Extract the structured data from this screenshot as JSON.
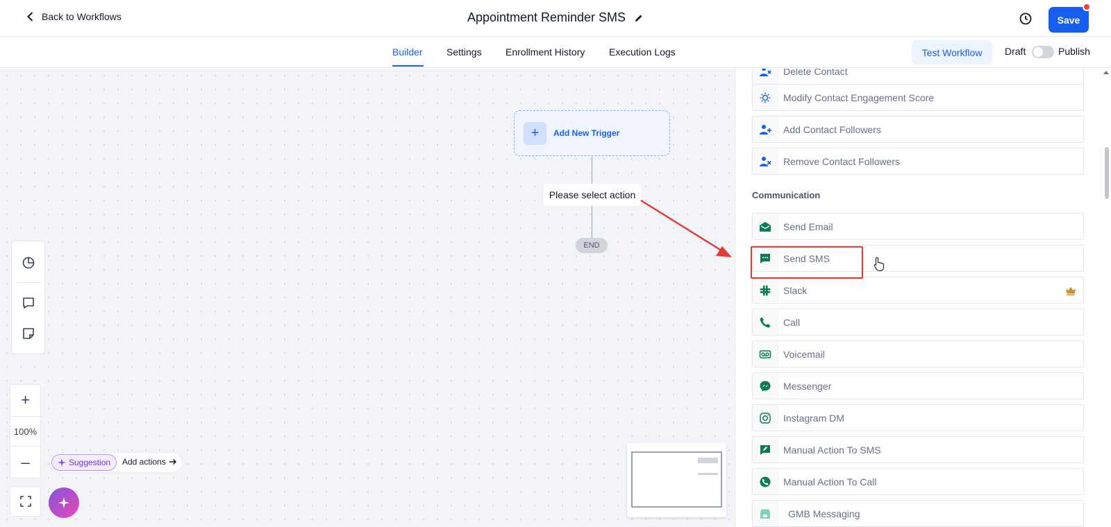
{
  "header": {
    "back_label": "Back to Workflows",
    "workflow_title": "Appointment Reminder SMS",
    "save_label": "Save"
  },
  "tabs": [
    {
      "label": "Builder",
      "active": true
    },
    {
      "label": "Settings",
      "active": false
    },
    {
      "label": "Enrollment History",
      "active": false
    },
    {
      "label": "Execution Logs",
      "active": false
    }
  ],
  "tab_actions": {
    "test_workflow_label": "Test Workflow",
    "draft_label": "Draft",
    "publish_label": "Publish",
    "publish_toggle_on": false
  },
  "canvas": {
    "trigger_label": "Add New Trigger",
    "action_placeholder": "Please select action",
    "end_label": "END",
    "zoom_level": "100%",
    "suggestion_label": "Suggestion",
    "add_actions_label": "Add actions"
  },
  "panel": {
    "top_rows": [
      {
        "label": "Delete Contact",
        "icon": "user-x-icon"
      },
      {
        "label": "Modify Contact Engagement Score",
        "icon": "engagement-icon"
      },
      {
        "label": "Add Contact Followers",
        "icon": "user-plus-icon"
      },
      {
        "label": "Remove Contact Followers",
        "icon": "user-remove-icon"
      }
    ],
    "section_title": "Communication",
    "communication_rows": [
      {
        "label": "Send Email",
        "icon": "mail-icon"
      },
      {
        "label": "Send SMS",
        "icon": "sms-icon",
        "highlighted": true
      },
      {
        "label": "Slack",
        "icon": "slack-icon",
        "premium": true
      },
      {
        "label": "Call",
        "icon": "phone-icon"
      },
      {
        "label": "Voicemail",
        "icon": "voicemail-icon"
      },
      {
        "label": "Messenger",
        "icon": "messenger-icon"
      },
      {
        "label": "Instagram DM",
        "icon": "instagram-icon"
      },
      {
        "label": "Manual Action To SMS",
        "icon": "manual-sms-icon"
      },
      {
        "label": "Manual Action To Call",
        "icon": "manual-call-icon"
      },
      {
        "label": "GMB Messaging",
        "icon": "gmb-icon"
      }
    ]
  },
  "colors": {
    "primary": "#155eef",
    "annotation_red": "#e53935",
    "icon_green": "#0e7a55",
    "icon_blue": "#155eef"
  }
}
